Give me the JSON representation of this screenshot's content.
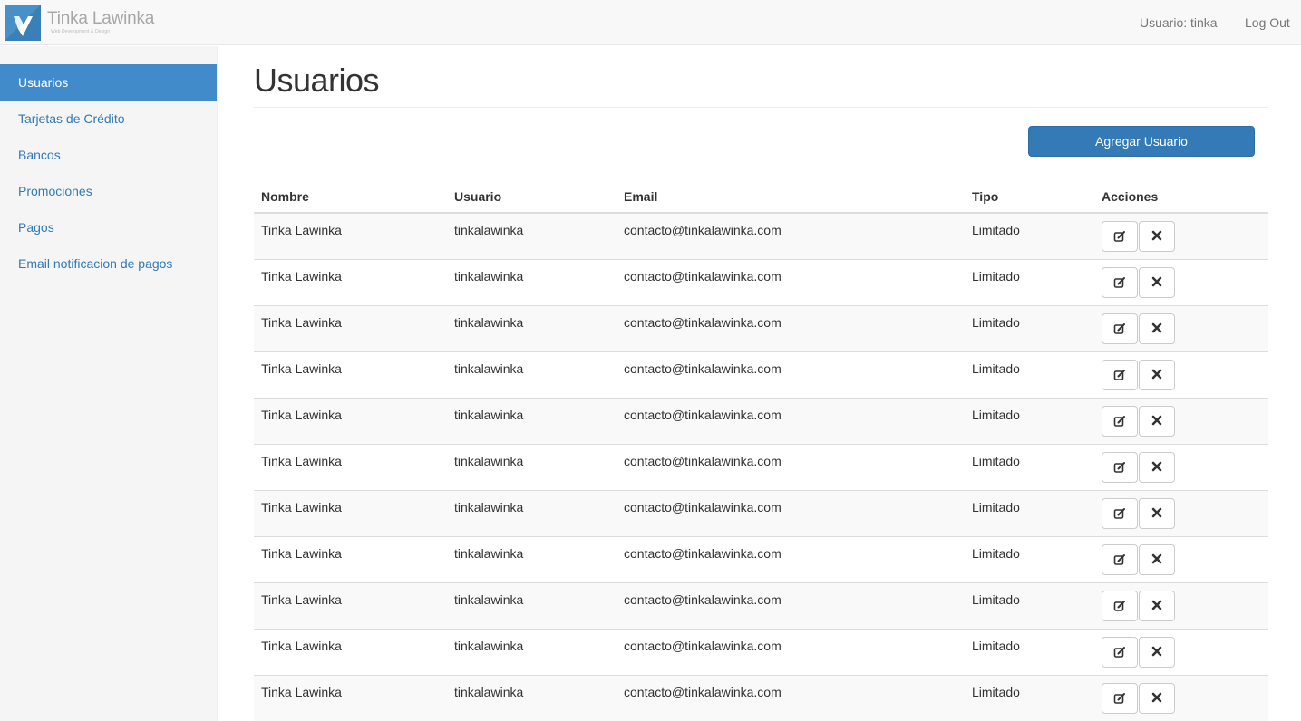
{
  "navbar": {
    "brand_title": "Tinka Lawinka",
    "brand_subtitle": "Web Development & Design",
    "user_label": "Usuario: tinka",
    "logout_label": "Log Out"
  },
  "sidebar": {
    "items": [
      {
        "label": "Usuarios",
        "active": true
      },
      {
        "label": "Tarjetas de Crédito",
        "active": false
      },
      {
        "label": "Bancos",
        "active": false
      },
      {
        "label": "Promociones",
        "active": false
      },
      {
        "label": "Pagos",
        "active": false
      },
      {
        "label": "Email notificacion de pagos",
        "active": false
      }
    ]
  },
  "main": {
    "title": "Usuarios",
    "add_button": "Agregar Usuario",
    "table": {
      "headers": [
        "Nombre",
        "Usuario",
        "Email",
        "Tipo",
        "Acciones"
      ],
      "rows": [
        {
          "nombre": "Tinka Lawinka",
          "usuario": "tinkalawinka",
          "email": "contacto@tinkalawinka.com",
          "tipo": "Limitado"
        },
        {
          "nombre": "Tinka Lawinka",
          "usuario": "tinkalawinka",
          "email": "contacto@tinkalawinka.com",
          "tipo": "Limitado"
        },
        {
          "nombre": "Tinka Lawinka",
          "usuario": "tinkalawinka",
          "email": "contacto@tinkalawinka.com",
          "tipo": "Limitado"
        },
        {
          "nombre": "Tinka Lawinka",
          "usuario": "tinkalawinka",
          "email": "contacto@tinkalawinka.com",
          "tipo": "Limitado"
        },
        {
          "nombre": "Tinka Lawinka",
          "usuario": "tinkalawinka",
          "email": "contacto@tinkalawinka.com",
          "tipo": "Limitado"
        },
        {
          "nombre": "Tinka Lawinka",
          "usuario": "tinkalawinka",
          "email": "contacto@tinkalawinka.com",
          "tipo": "Limitado"
        },
        {
          "nombre": "Tinka Lawinka",
          "usuario": "tinkalawinka",
          "email": "contacto@tinkalawinka.com",
          "tipo": "Limitado"
        },
        {
          "nombre": "Tinka Lawinka",
          "usuario": "tinkalawinka",
          "email": "contacto@tinkalawinka.com",
          "tipo": "Limitado"
        },
        {
          "nombre": "Tinka Lawinka",
          "usuario": "tinkalawinka",
          "email": "contacto@tinkalawinka.com",
          "tipo": "Limitado"
        },
        {
          "nombre": "Tinka Lawinka",
          "usuario": "tinkalawinka",
          "email": "contacto@tinkalawinka.com",
          "tipo": "Limitado"
        },
        {
          "nombre": "Tinka Lawinka",
          "usuario": "tinkalawinka",
          "email": "contacto@tinkalawinka.com",
          "tipo": "Limitado"
        }
      ],
      "row_actions": [
        {
          "icon": "edit-icon"
        },
        {
          "icon": "delete-icon"
        }
      ]
    }
  },
  "colors": {
    "primary": "#337ab7",
    "sidebar_active": "#428bca",
    "logo_bg": "#4a90c8",
    "navbar_bg": "#f8f8f8"
  }
}
